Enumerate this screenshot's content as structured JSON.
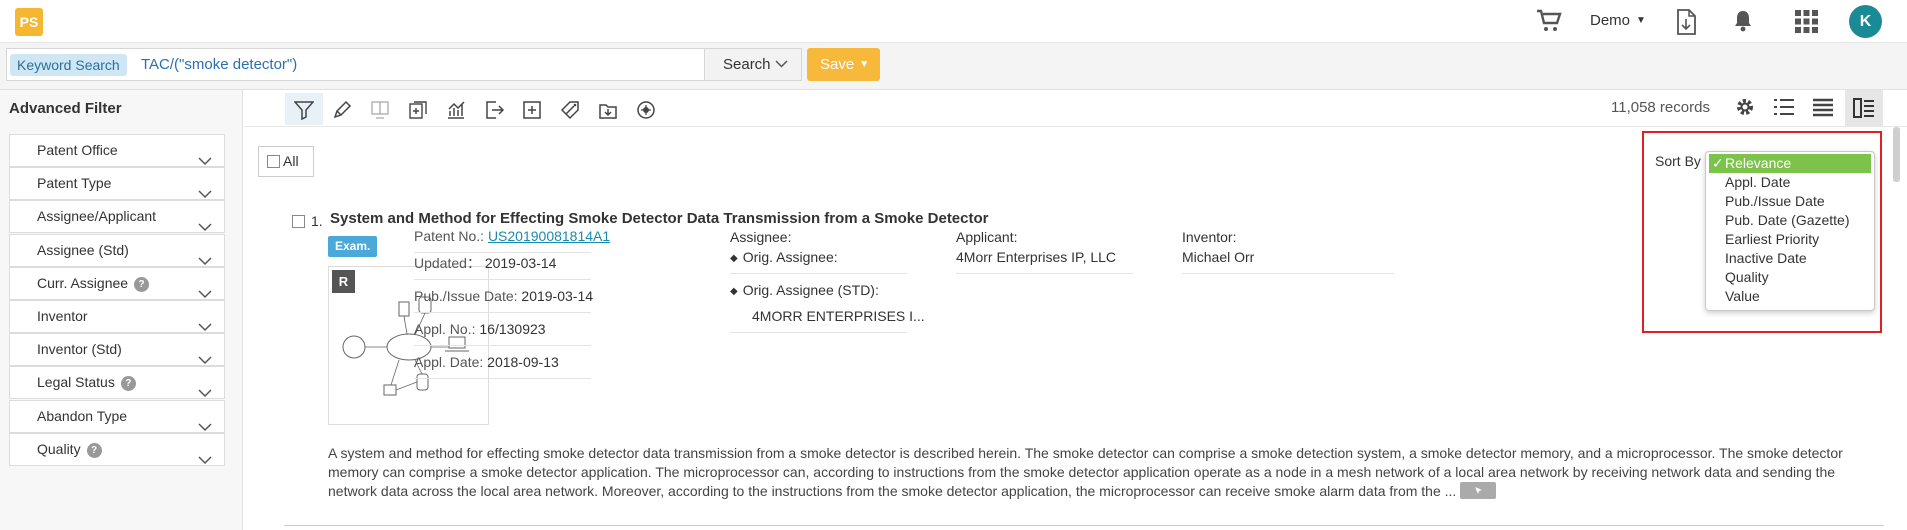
{
  "app": {
    "logo_text": "PS"
  },
  "topbar": {
    "user_menu": "Demo",
    "avatar_initial": "K"
  },
  "search": {
    "tag": "Keyword Search",
    "query": "TAC/(\"smoke detector\")",
    "search_label": "Search",
    "save_label": "Save"
  },
  "sidebar": {
    "title": "Advanced Filter",
    "filters": [
      {
        "label": "Patent Office",
        "help": false
      },
      {
        "label": "Patent Type",
        "help": false
      },
      {
        "label": "Assignee/Applicant",
        "help": false
      },
      {
        "label": "Assignee (Std)",
        "help": false
      },
      {
        "label": "Curr. Assignee",
        "help": true
      },
      {
        "label": "Inventor",
        "help": false
      },
      {
        "label": "Inventor (Std)",
        "help": false
      },
      {
        "label": "Legal Status",
        "help": true
      },
      {
        "label": "Abandon Type",
        "help": false
      },
      {
        "label": "Quality",
        "help": true
      }
    ]
  },
  "toolbar": {
    "records": "11,058 records"
  },
  "results": {
    "all_label": "All",
    "sort_label": "Sort By",
    "items": [
      {
        "num": "1.",
        "title": "System and Method for Effecting Smoke Detector Data Transmission from a Smoke Detector",
        "badge": "Exam.",
        "thumb_badge": "R",
        "patent_no_label": "Patent No.:",
        "patent_no": "US20190081814A1",
        "updated_label": "Updated：",
        "updated": "2019-03-14",
        "pub_label": "Pub./Issue Date:",
        "pub": "2019-03-14",
        "appl_no_label": "Appl. No.:",
        "appl_no": "16/130923",
        "appl_date_label": "Appl. Date:",
        "appl_date": "2018-09-13",
        "assignee_label": "Assignee:",
        "orig_assignee_label": "Orig. Assignee:",
        "orig_assignee_std_label": "Orig. Assignee (STD):",
        "orig_assignee_std": "4MORR ENTERPRISES I...",
        "applicant_label": "Applicant:",
        "applicant": "4Morr Enterprises IP, LLC",
        "inventor_label": "Inventor:",
        "inventor": "Michael Orr",
        "abstract": "A system and method for effecting smoke detector data transmission from a smoke detector is described herein. The smoke detector can comprise a smoke detection system, a smoke detector memory, and a microprocessor. The smoke detector memory can comprise a smoke detector application. The microprocessor can, according to instructions from the smoke detector application operate as a node in a mesh network of a local area network by receiving network data and sending the network data across the local area network. Moreover, according to the instructions from the smoke detector application, the microprocessor can receive smoke alarm data from the ..."
      }
    ]
  },
  "sort_dropdown": {
    "selected": "Relevance",
    "options": [
      "Relevance",
      "Appl. Date",
      "Pub./Issue Date",
      "Pub. Date (Gazette)",
      "Earliest Priority",
      "Inactive Date",
      "Quality",
      "Value"
    ]
  },
  "colors": {
    "accent": "#f6b93b",
    "brand": "#1a8b96",
    "selected_option": "#7dc24b",
    "highlight": "#e02020"
  }
}
